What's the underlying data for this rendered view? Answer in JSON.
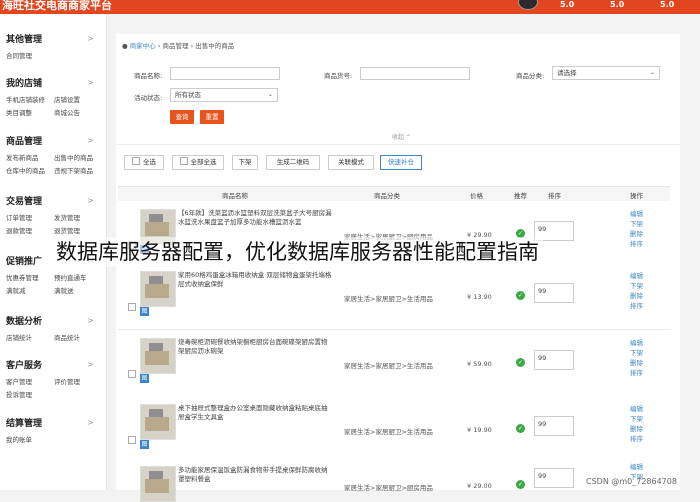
{
  "topbar": {
    "brand": "海旺社交电商商家平台",
    "stats": [
      "5.0",
      "5.0",
      "5.0"
    ]
  },
  "sidebar": [
    {
      "title": "其他管理",
      "items": [
        "合同管理"
      ]
    },
    {
      "title": "我的店铺",
      "items": [
        "手机店铺装修",
        "店铺设置",
        "类目调整",
        "商城公告"
      ]
    },
    {
      "title": "商品管理",
      "items": [
        "发布新商品",
        "出售中的商品",
        "仓库中的商品",
        "违规下架商品"
      ]
    },
    {
      "title": "交易管理",
      "items": [
        "订单管理",
        "发货管理",
        "退款管理",
        "退货管理"
      ]
    },
    {
      "title": "促销推广",
      "items": [
        "优惠券管理",
        "预约直通车",
        "满就减",
        "满就送"
      ]
    },
    {
      "title": "数据分析",
      "items": [
        "店铺统计",
        "商品统计"
      ]
    },
    {
      "title": "客户服务",
      "items": [
        "客户管理",
        "评价管理",
        "投诉管理"
      ]
    },
    {
      "title": "结算管理",
      "items": [
        "我的账单"
      ]
    }
  ],
  "breadcrumb": {
    "home": "商家中心",
    "sep": "›",
    "level1": "商品管理",
    "level2": "出售中的商品"
  },
  "filters": {
    "name_label": "商品名称:",
    "code_label": "商品货号:",
    "category_label": "商品分类:",
    "category_value": "请选择",
    "status_label": "活动状态:",
    "status_value": "所有状态",
    "search_btn": "查询",
    "reset_btn": "重置",
    "collapse": "收起 ⌃"
  },
  "actions": [
    "全选",
    "全部全选",
    "下架",
    "生成二维码",
    "关联模式",
    "快速补仓"
  ],
  "table": {
    "headers": [
      "商品名称",
      "商品分类",
      "价格",
      "推荐",
      "排序",
      "操作"
    ],
    "ops": [
      "编辑",
      "下架",
      "删除",
      "排序"
    ],
    "tag": "图",
    "rows": [
      {
        "name": "【6年款】洗菜篮沥水篮塑料双层洗菜盆子大号厨房漏水篮洗水果盘篮子加厚多功能水槽篮沥水篮",
        "category": "家居生活>家居厨卫>厨房用品",
        "price": "¥ 29.90",
        "sort": "99"
      },
      {
        "name": "家用60格鸡蛋盒冰箱用收纳盒 双层储物盒蛋架托端格层式收纳盒保鲜",
        "category": "家居生活>家居厨卫>生活用品",
        "price": "¥ 13.90",
        "sort": "99"
      },
      {
        "name": "烧毒碗柜沥碗餐收纳架橱柜厨房台面碗碟架厨房置物架厨房沥水碗架",
        "category": "家居生活>家居厨卫>生活用品",
        "price": "¥ 59.90",
        "sort": "99"
      },
      {
        "name": "桌下抽屉式整理盒办公室桌面隐藏收纳盒粘贴桌底抽屉盒学生文具盒",
        "category": "家居生活>家居厨卫>生活用品",
        "price": "¥ 19.90",
        "sort": "99"
      },
      {
        "name": "多功能家居保温饭盒防漏食物带手提桌保鲜防腐收纳罩塑料餐盒",
        "category": "家居生活>家居厨卫>厨房用品",
        "price": "¥ 29.00",
        "sort": "99"
      }
    ]
  },
  "overlay_text": "数据库服务器配置，优化数据库服务器性能配置指南",
  "watermark": "CSDN @m0_72864708",
  "colors": {
    "brand": "#e2461e",
    "button": "#e8541e",
    "link": "#3a86c8",
    "check": "#3aa843"
  }
}
